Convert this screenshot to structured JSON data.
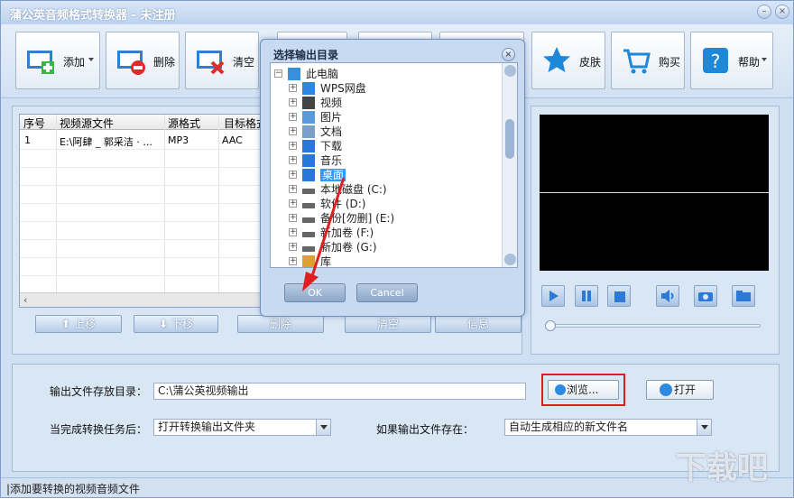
{
  "window": {
    "title": "蒲公英音频格式转换器 - 未注册"
  },
  "toolbar": {
    "add_label": "添加",
    "delete_label": "删除",
    "clear_label": "清空",
    "skin_label": "皮肤",
    "buy_label": "购买",
    "help_label": "帮助"
  },
  "table": {
    "headers": [
      "序号",
      "视频源文件",
      "源格式",
      "目标格式"
    ],
    "rows": [
      {
        "index": "1",
        "source": "E:\\阿肆 _ 郭采洁 · ...",
        "src_format": "MP3",
        "dst_format": "AAC"
      }
    ]
  },
  "list_buttons": {
    "up": "上移",
    "down": "下移",
    "delete": "删除",
    "clear": "清空",
    "info": "信息"
  },
  "output": {
    "dir_label": "输出文件存放目录：",
    "dir_value": "C:\\蒲公英视频输出",
    "browse_label": "浏览...",
    "open_label": "打开",
    "after_label": "当完成转换任务后：",
    "after_value": "打开转换输出文件夹",
    "exists_label": "如果输出文件存在：",
    "exists_value": "自动生成相应的新文件名"
  },
  "status": {
    "text": "|添加要转换的视频音频文件"
  },
  "dialog": {
    "title": "选择输出目录",
    "ok": "OK",
    "cancel": "Cancel",
    "tree": [
      {
        "label": "此电脑",
        "expander": "−",
        "icon": "computer-icon"
      },
      {
        "label": "WPS网盘",
        "expander": "+",
        "icon": "cloud-icon"
      },
      {
        "label": "视频",
        "expander": "+",
        "icon": "video-folder-icon"
      },
      {
        "label": "图片",
        "expander": "+",
        "icon": "picture-folder-icon"
      },
      {
        "label": "文档",
        "expander": "+",
        "icon": "document-folder-icon"
      },
      {
        "label": "下载",
        "expander": "+",
        "icon": "download-icon"
      },
      {
        "label": "音乐",
        "expander": "+",
        "icon": "music-icon"
      },
      {
        "label": "桌面",
        "expander": "+",
        "icon": "desktop-icon"
      },
      {
        "label": "本地磁盘 (C:)",
        "expander": "+",
        "icon": "drive-icon"
      },
      {
        "label": "软件 (D:)",
        "expander": "+",
        "icon": "drive-icon"
      },
      {
        "label": "备份[勿删] (E:)",
        "expander": "+",
        "icon": "drive-icon"
      },
      {
        "label": "新加卷 (F:)",
        "expander": "+",
        "icon": "drive-icon"
      },
      {
        "label": "新加卷 (G:)",
        "expander": "+",
        "icon": "drive-icon"
      },
      {
        "label": "库",
        "expander": "+",
        "icon": "library-icon"
      }
    ]
  },
  "watermark": "下载吧"
}
